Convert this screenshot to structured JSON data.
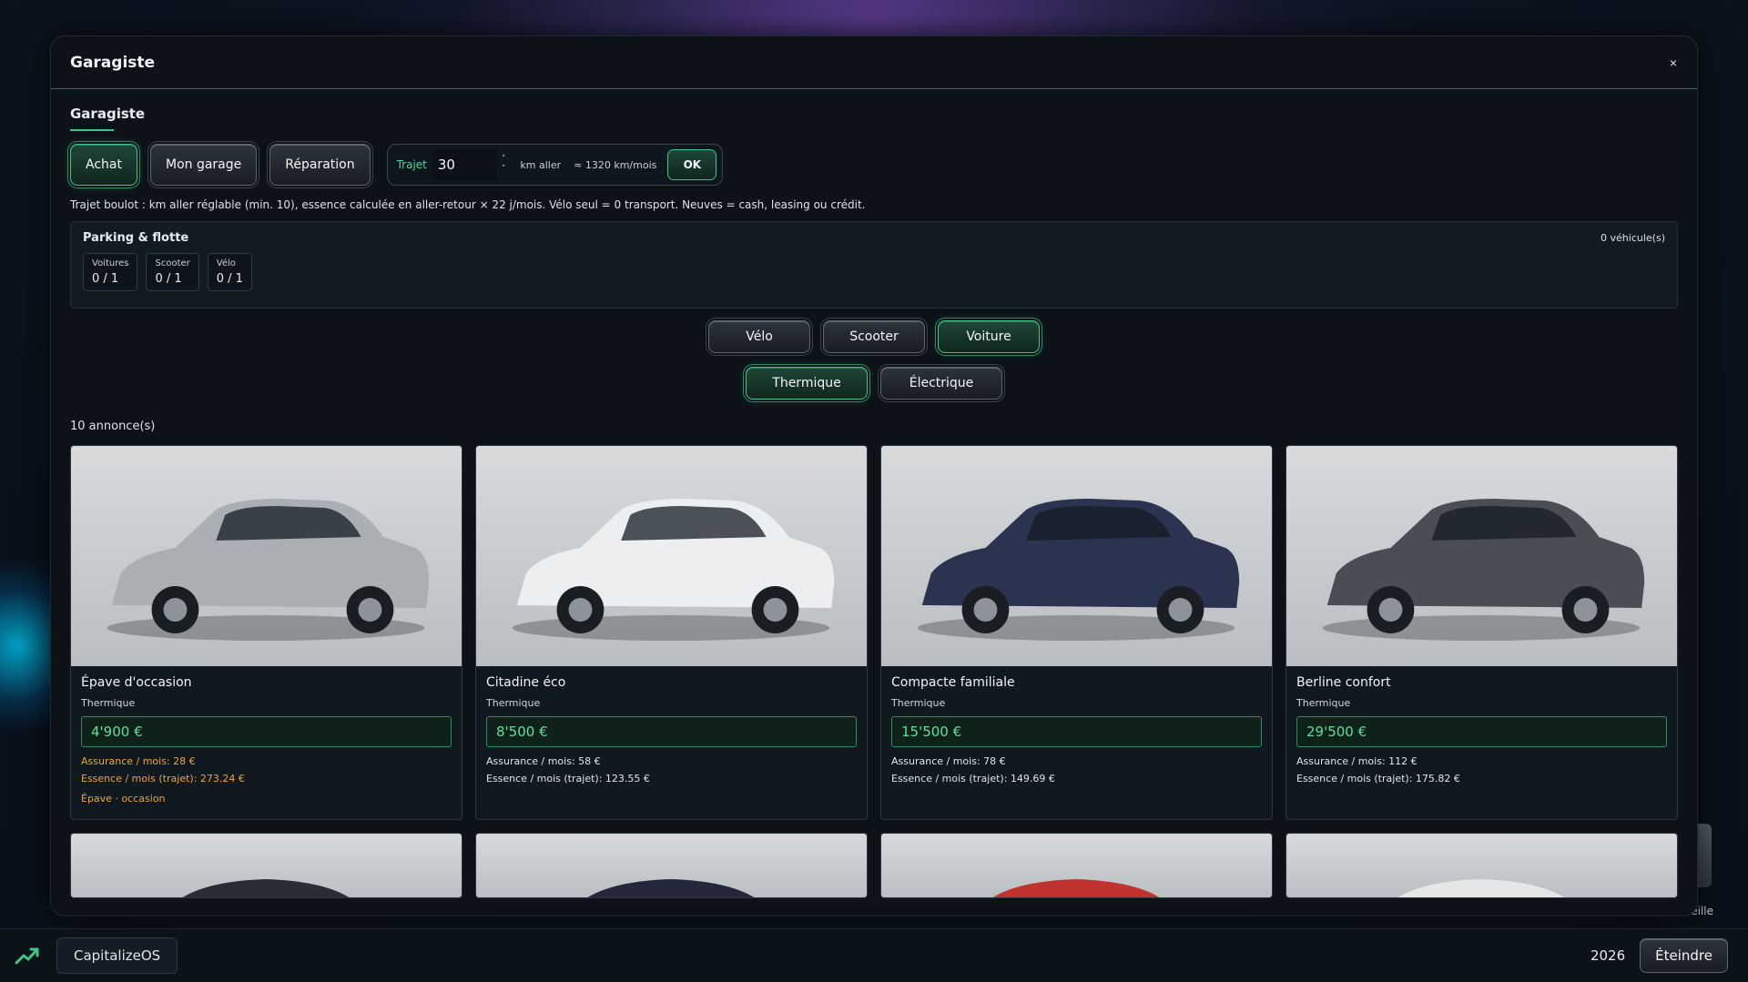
{
  "window": {
    "title": "Garagiste",
    "close": "×"
  },
  "section": {
    "tab": "Garagiste"
  },
  "toolbar": {
    "buttons": [
      {
        "label": "Achat",
        "active": true
      },
      {
        "label": "Mon garage",
        "active": false
      },
      {
        "label": "Réparation",
        "active": false
      }
    ],
    "trajet": {
      "label": "Trajet",
      "value": "30",
      "unit": "km aller",
      "calc": "≈ 1320 km/mois",
      "ok": "OK"
    }
  },
  "hint": "Trajet boulot : km aller réglable (min. 10), essence calculée en aller-retour × 22 j/mois. Vélo seul = 0 transport. Neuves = cash, leasing ou crédit.",
  "parking": {
    "title": "Parking & flotte",
    "count": "0 véhicule(s)",
    "slots": [
      {
        "label": "Voitures",
        "value": "0 / 1"
      },
      {
        "label": "Scooter",
        "value": "0 / 1"
      },
      {
        "label": "Vélo",
        "value": "0 / 1"
      }
    ]
  },
  "filters": {
    "type": [
      {
        "label": "Vélo",
        "active": false
      },
      {
        "label": "Scooter",
        "active": false
      },
      {
        "label": "Voiture",
        "active": true
      }
    ],
    "energy": [
      {
        "label": "Thermique",
        "active": true
      },
      {
        "label": "Électrique",
        "active": false
      }
    ]
  },
  "listings": {
    "count": "10 annonce(s)",
    "cards": [
      {
        "title": "Épave d'occasion",
        "type": "Thermique",
        "price": "4'900 €",
        "insurance": "Assurance / mois: 28 €",
        "fuel": "Essence / mois (trajet): 273.24 €",
        "tag": "Épave · occasion",
        "warn": true,
        "car_color": "#a9afb3"
      },
      {
        "title": "Citadine éco",
        "type": "Thermique",
        "price": "8'500 €",
        "insurance": "Assurance / mois: 58 €",
        "fuel": "Essence / mois (trajet): 123.55 €",
        "tag": "",
        "warn": false,
        "car_color": "#eceeef"
      },
      {
        "title": "Compacte familiale",
        "type": "Thermique",
        "price": "15'500 €",
        "insurance": "Assurance / mois: 78 €",
        "fuel": "Essence / mois (trajet): 149.69 €",
        "tag": "",
        "warn": false,
        "car_color": "#2a3350"
      },
      {
        "title": "Berline confort",
        "type": "Thermique",
        "price": "29'500 €",
        "insurance": "Assurance / mois: 112 €",
        "fuel": "Essence / mois (trajet): 175.82 €",
        "tag": "",
        "warn": false,
        "car_color": "#4a4e54"
      }
    ],
    "partial_colors": [
      "#2a2d33",
      "#22273a",
      "#c0332e",
      "#e4e6e8"
    ]
  },
  "desktop": {
    "tile_label": "eille"
  },
  "taskbar": {
    "app": "CapitalizeOS",
    "year": "2026",
    "power": "Éteindre",
    "accent": "#3ec58a"
  }
}
